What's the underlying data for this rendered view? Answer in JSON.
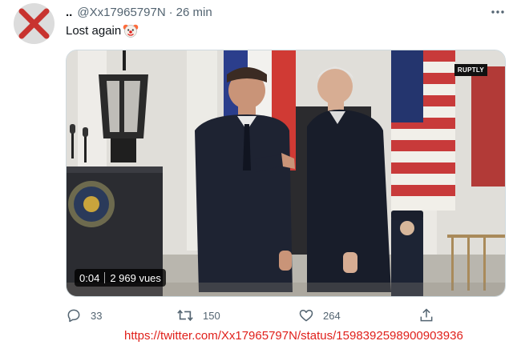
{
  "tweet": {
    "display_name": "..",
    "handle": "@Xx17965797N",
    "separator": "·",
    "time_ago": "26 min",
    "text": "Lost again",
    "emoji": "clown-face"
  },
  "media": {
    "watermark": "RUPTLY",
    "timestamp": "0:04",
    "views": "2 969 vues"
  },
  "actions": {
    "reply_count": "33",
    "retweet_count": "150",
    "like_count": "264"
  },
  "source_url": "https://twitter.com/Xx17965797N/status/1598392598900903936",
  "colors": {
    "url_red": "#e0201b",
    "meta_gray": "#536471",
    "avatar_x": "#c8332f"
  }
}
